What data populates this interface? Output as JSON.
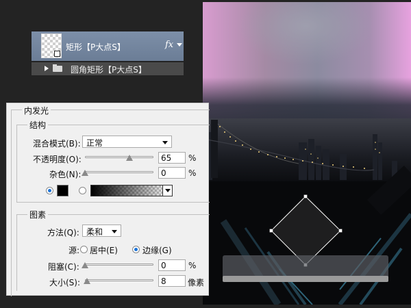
{
  "layers": {
    "selected_layer_name": "矩形【P大点S】",
    "fx_label": "fx",
    "child_layer_name": "圆角矩形【P大点S】"
  },
  "dialog": {
    "section_title": "内发光",
    "structure": {
      "title": "结构",
      "blend_mode_label": "混合模式(B):",
      "blend_mode_value": "正常",
      "opacity_label": "不透明度(O):",
      "opacity_value": "65",
      "opacity_unit": "%",
      "noise_label": "杂色(N):",
      "noise_value": "0",
      "noise_unit": "%",
      "glow_color": "#000000",
      "opacity_fraction": 0.65,
      "noise_fraction": 0.0
    },
    "elements": {
      "title": "图素",
      "technique_label": "方法(Q):",
      "technique_value": "柔和",
      "source_label": "源:",
      "source_center_label": "居中(E)",
      "source_edge_label": "边缘(G)",
      "choke_label": "阻塞(C):",
      "choke_value": "0",
      "choke_unit": "%",
      "size_label": "大小(S):",
      "size_value": "8",
      "size_unit": "像素",
      "choke_fraction": 0.0,
      "size_fraction": 0.03
    }
  },
  "colors": {
    "selection_blue": "#6b7d96",
    "radio_accent": "#1a73d9"
  }
}
